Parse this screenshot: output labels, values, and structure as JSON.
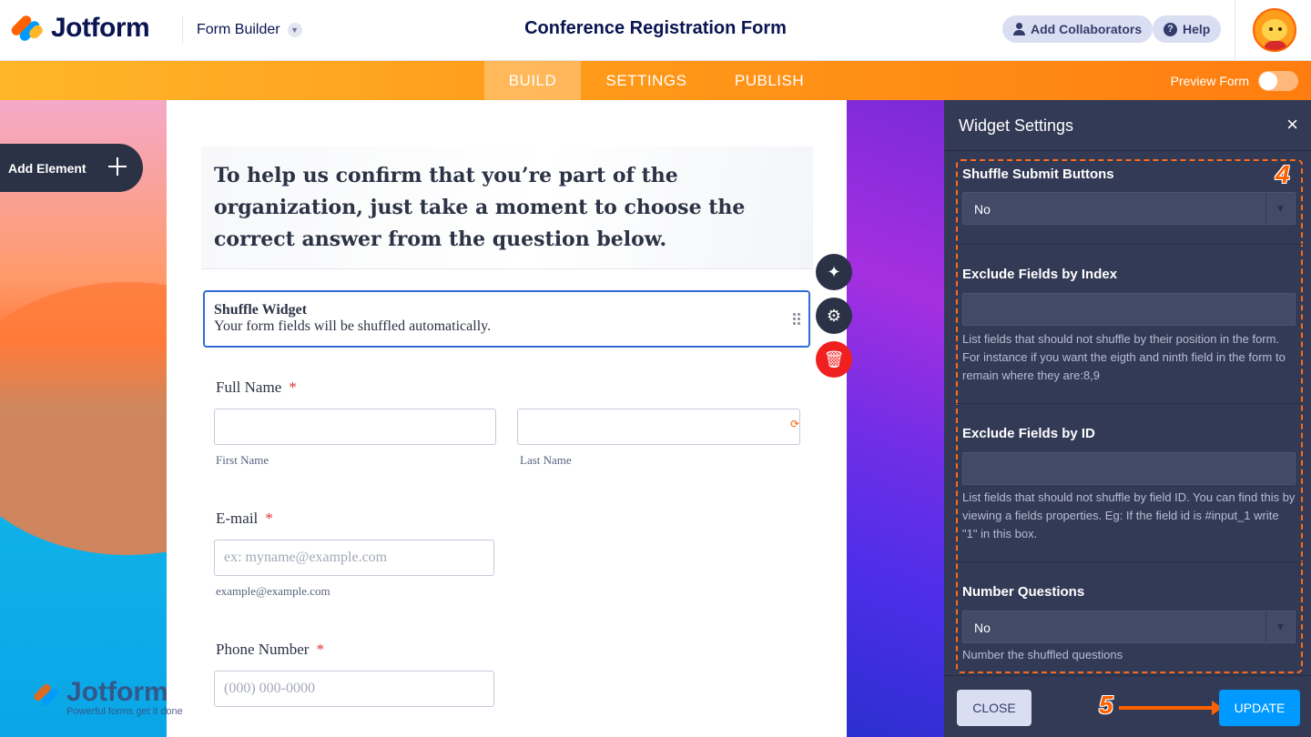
{
  "topbar": {
    "brand": "Jotform",
    "builder_label": "Form Builder",
    "form_title": "Conference Registration Form",
    "collaborators_label": "Add Collaborators",
    "help_label": "Help"
  },
  "nav": {
    "tabs": [
      {
        "label": "BUILD",
        "active": true
      },
      {
        "label": "SETTINGS",
        "active": false
      },
      {
        "label": "PUBLISH",
        "active": false
      }
    ],
    "preview_label": "Preview Form"
  },
  "canvas": {
    "add_element_label": "Add Element",
    "header_text": "To help us confirm that you’re part of the organization, just take a moment to choose the correct answer from the question below.",
    "widget": {
      "title": "Shuffle Widget",
      "description": "Your form fields will be shuffled automatically."
    },
    "fields": {
      "full_name": {
        "label": "Full Name",
        "required_mark": "*",
        "first_sublabel": "First Name",
        "last_sublabel": "Last Name"
      },
      "email": {
        "label": "E-mail",
        "required_mark": "*",
        "placeholder": "ex: myname@example.com",
        "sublabel": "example@example.com"
      },
      "phone": {
        "label": "Phone Number",
        "required_mark": "*",
        "placeholder": "(000) 000-0000"
      }
    },
    "footer_brand": "Jotform",
    "footer_tagline": "Powerful forms get it done"
  },
  "panel": {
    "title": "Widget Settings",
    "close_icon": "×",
    "settings": {
      "shuffle_submit": {
        "label": "Shuffle Submit Buttons",
        "value": "No"
      },
      "exclude_index": {
        "label": "Exclude Fields by Index",
        "value": "",
        "help": "List fields that should not shuffle by their position in the form. For instance if you want the eigth and ninth field in the form to remain where they are:8,9"
      },
      "exclude_id": {
        "label": "Exclude Fields by ID",
        "value": "",
        "help": "List fields that should not shuffle by field ID. You can find this by viewing a fields properties. Eg: If the field id is #input_1 write \"1\" in this box."
      },
      "number_questions": {
        "label": "Number Questions",
        "value": "No",
        "help": "Number the shuffled questions"
      }
    },
    "step_badge_settings": "4",
    "step_badge_update": "5",
    "close_button": "CLOSE",
    "update_button": "UPDATE"
  },
  "colors": {
    "accent_orange": "#ff6100",
    "primary_blue": "#0099ff",
    "panel_bg": "#323a55",
    "selected_border": "#2f6bd6"
  }
}
